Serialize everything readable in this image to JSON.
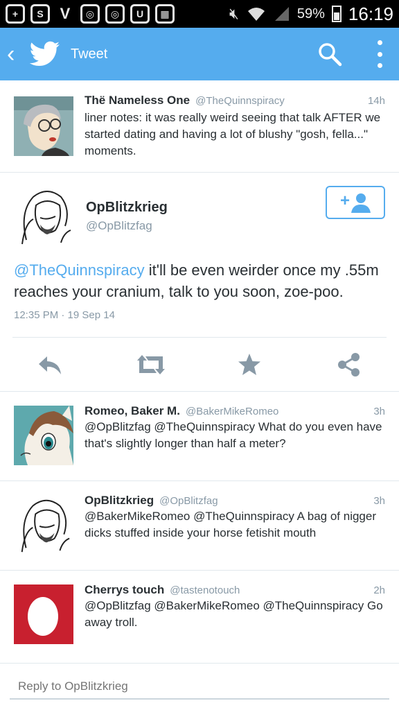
{
  "status_bar": {
    "battery": "59%",
    "time": "16:19"
  },
  "header": {
    "title": "Tweet"
  },
  "prev_tweet": {
    "name": "Thë Nameless One",
    "handle": "@TheQuinnspiracy",
    "time": "14h",
    "text": "liner notes: it was really weird seeing that talk AFTER we started dating and having a lot of blushy \"gosh, fella...\" moments."
  },
  "main_tweet": {
    "name": "OpBlitzkrieg",
    "handle": "@OpBlitzfag",
    "mention": "@TheQuinnspiracy",
    "text": " it'll be even weirder once my .55m reaches your cranium, talk to you soon, zoe-poo.",
    "timestamp": "12:35 PM · 19 Sep 14"
  },
  "replies": [
    {
      "name": "Romeo, Baker M.",
      "handle": "@BakerMikeRomeo",
      "time": "3h",
      "text": "@OpBlitzfag @TheQuinnspiracy What do you even have that's slightly longer than half a meter?"
    },
    {
      "name": "OpBlitzkrieg",
      "handle": "@OpBlitzfag",
      "time": "3h",
      "text": "@BakerMikeRomeo @TheQuinnspiracy A bag of nigger dicks stuffed inside your horse fetishit mouth"
    },
    {
      "name": "Cherrys touch",
      "handle": "@tastenotouch",
      "time": "2h",
      "text": "@OpBlitzfag @BakerMikeRomeo @TheQuinnspiracy Go away troll."
    }
  ],
  "reply_box": {
    "placeholder": "Reply to OpBlitzkrieg"
  },
  "colors": {
    "brand": "#55acee",
    "text": "#292f33",
    "muted": "#8899a6"
  }
}
